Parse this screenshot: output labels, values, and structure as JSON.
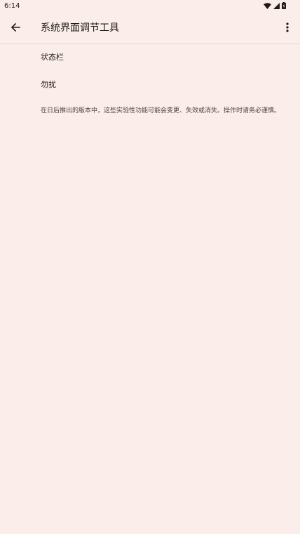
{
  "status_bar": {
    "time": "6:14",
    "icons": [
      "wifi-icon",
      "cellular-signal-icon",
      "battery-icon"
    ]
  },
  "app_bar": {
    "title": "系统界面调节工具",
    "back_icon": "arrow-back-icon",
    "menu_icon": "more-vert-icon"
  },
  "preferences": {
    "items": [
      {
        "label": "状态栏"
      },
      {
        "label": "勿扰"
      }
    ],
    "footer": "在日后推出的版本中，这些实验性功能可能会变更、失效或消失。操作时请务必谨慎。"
  },
  "colors": {
    "background": "#fbeeea",
    "text_primary": "#201a19",
    "text_secondary": "#534341"
  }
}
